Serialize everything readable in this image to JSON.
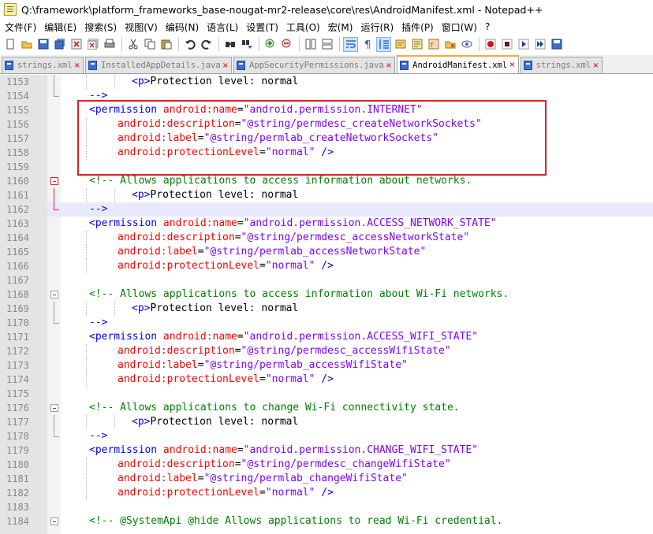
{
  "window": {
    "title": "Q:\\framework\\platform_frameworks_base-nougat-mr2-release\\core\\res\\AndroidManifest.xml - Notepad++"
  },
  "menu": [
    "文件(F)",
    "编辑(E)",
    "搜索(S)",
    "视图(V)",
    "编码(N)",
    "语言(L)",
    "设置(T)",
    "工具(O)",
    "宏(M)",
    "运行(R)",
    "插件(P)",
    "窗口(W)",
    "?"
  ],
  "toolbar": {
    "icons": [
      "new-file-icon",
      "open-file-icon",
      "save-icon",
      "save-all-icon",
      "close-icon",
      "close-all-icon",
      "print-icon",
      "cut-icon",
      "copy-icon",
      "paste-icon",
      "undo-icon",
      "redo-icon",
      "find-icon",
      "replace-icon",
      "zoom-in-icon",
      "zoom-out-icon",
      "sync-vertical-icon",
      "sync-horizontal-icon",
      "word-wrap-icon",
      "show-all-chars-icon",
      "indent-guide-icon",
      "udl-icon",
      "doc-map-icon",
      "function-list-icon",
      "folder-workspace-icon",
      "monitoring-icon",
      "record-macro-icon",
      "stop-record-icon",
      "play-macro-icon",
      "run-macro-multiple-icon",
      "save-macro-icon"
    ]
  },
  "tabs": [
    {
      "label": "strings.xml",
      "active": false
    },
    {
      "label": "InstalledAppDetails.java",
      "active": false
    },
    {
      "label": "AppSecurityPermissions.java",
      "active": false
    },
    {
      "label": "AndroidManifest.xml",
      "active": true
    },
    {
      "label": "strings.xml",
      "active": false
    }
  ],
  "editor": {
    "current_line": "1162",
    "lines": [
      {
        "n": "1153",
        "fold": "vline",
        "indent": 10,
        "segs": [
          [
            "tag",
            "<p>"
          ],
          [
            "plain",
            "Protection level: normal"
          ]
        ]
      },
      {
        "n": "1154",
        "fold": "end",
        "indent": 4,
        "segs": [
          [
            "tag",
            "-->"
          ]
        ]
      },
      {
        "n": "1155",
        "fold": "",
        "indent": 4,
        "segs": [
          [
            "tag",
            "<permission "
          ],
          [
            "attr",
            "android:name"
          ],
          [
            "plain",
            "="
          ],
          [
            "val",
            "\"android.permission.INTERNET\""
          ]
        ]
      },
      {
        "n": "1156",
        "fold": "",
        "indent": 8,
        "segs": [
          [
            "attr",
            "android:description"
          ],
          [
            "plain",
            "="
          ],
          [
            "val",
            "\"@string/permdesc_createNetworkSockets\""
          ]
        ]
      },
      {
        "n": "1157",
        "fold": "",
        "indent": 8,
        "segs": [
          [
            "attr",
            "android:label"
          ],
          [
            "plain",
            "="
          ],
          [
            "val",
            "\"@string/permlab_createNetworkSockets\""
          ]
        ]
      },
      {
        "n": "1158",
        "fold": "",
        "indent": 8,
        "segs": [
          [
            "attr",
            "android:protectionLevel"
          ],
          [
            "plain",
            "="
          ],
          [
            "val",
            "\"normal\""
          ],
          [
            "tag",
            " />"
          ]
        ]
      },
      {
        "n": "1159",
        "fold": "",
        "indent": 0,
        "segs": []
      },
      {
        "n": "1160",
        "fold": "box-red",
        "indent": 4,
        "segs": [
          [
            "cmt",
            "<!-- Allows applications to access information about networks."
          ]
        ]
      },
      {
        "n": "1161",
        "fold": "vline-red",
        "indent": 10,
        "segs": [
          [
            "tag",
            "<p>"
          ],
          [
            "plain",
            "Protection level: normal"
          ]
        ]
      },
      {
        "n": "1162",
        "fold": "end-red",
        "indent": 4,
        "segs": [
          [
            "tag",
            "-->"
          ]
        ]
      },
      {
        "n": "1163",
        "fold": "",
        "indent": 4,
        "segs": [
          [
            "tag",
            "<permission "
          ],
          [
            "attr",
            "android:name"
          ],
          [
            "plain",
            "="
          ],
          [
            "val",
            "\"android.permission.ACCESS_NETWORK_STATE\""
          ]
        ]
      },
      {
        "n": "1164",
        "fold": "",
        "indent": 8,
        "segs": [
          [
            "attr",
            "android:description"
          ],
          [
            "plain",
            "="
          ],
          [
            "val",
            "\"@string/permdesc_accessNetworkState\""
          ]
        ]
      },
      {
        "n": "1165",
        "fold": "",
        "indent": 8,
        "segs": [
          [
            "attr",
            "android:label"
          ],
          [
            "plain",
            "="
          ],
          [
            "val",
            "\"@string/permlab_accessNetworkState\""
          ]
        ]
      },
      {
        "n": "1166",
        "fold": "",
        "indent": 8,
        "segs": [
          [
            "attr",
            "android:protectionLevel"
          ],
          [
            "plain",
            "="
          ],
          [
            "val",
            "\"normal\""
          ],
          [
            "tag",
            " />"
          ]
        ]
      },
      {
        "n": "1167",
        "fold": "",
        "indent": 0,
        "segs": []
      },
      {
        "n": "1168",
        "fold": "box",
        "indent": 4,
        "segs": [
          [
            "cmt",
            "<!-- Allows applications to access information about Wi-Fi networks."
          ]
        ]
      },
      {
        "n": "1169",
        "fold": "vline",
        "indent": 10,
        "segs": [
          [
            "tag",
            "<p>"
          ],
          [
            "plain",
            "Protection level: normal"
          ]
        ]
      },
      {
        "n": "1170",
        "fold": "end",
        "indent": 4,
        "segs": [
          [
            "tag",
            "-->"
          ]
        ]
      },
      {
        "n": "1171",
        "fold": "",
        "indent": 4,
        "segs": [
          [
            "tag",
            "<permission "
          ],
          [
            "attr",
            "android:name"
          ],
          [
            "plain",
            "="
          ],
          [
            "val",
            "\"android.permission.ACCESS_WIFI_STATE\""
          ]
        ]
      },
      {
        "n": "1172",
        "fold": "",
        "indent": 8,
        "segs": [
          [
            "attr",
            "android:description"
          ],
          [
            "plain",
            "="
          ],
          [
            "val",
            "\"@string/permdesc_accessWifiState\""
          ]
        ]
      },
      {
        "n": "1173",
        "fold": "",
        "indent": 8,
        "segs": [
          [
            "attr",
            "android:label"
          ],
          [
            "plain",
            "="
          ],
          [
            "val",
            "\"@string/permlab_accessWifiState\""
          ]
        ]
      },
      {
        "n": "1174",
        "fold": "",
        "indent": 8,
        "segs": [
          [
            "attr",
            "android:protectionLevel"
          ],
          [
            "plain",
            "="
          ],
          [
            "val",
            "\"normal\""
          ],
          [
            "tag",
            " />"
          ]
        ]
      },
      {
        "n": "1175",
        "fold": "",
        "indent": 0,
        "segs": []
      },
      {
        "n": "1176",
        "fold": "box",
        "indent": 4,
        "segs": [
          [
            "cmt",
            "<!-- Allows applications to change Wi-Fi connectivity state."
          ]
        ]
      },
      {
        "n": "1177",
        "fold": "vline",
        "indent": 10,
        "segs": [
          [
            "tag",
            "<p>"
          ],
          [
            "plain",
            "Protection level: normal"
          ]
        ]
      },
      {
        "n": "1178",
        "fold": "end",
        "indent": 4,
        "segs": [
          [
            "tag",
            "-->"
          ]
        ]
      },
      {
        "n": "1179",
        "fold": "",
        "indent": 4,
        "segs": [
          [
            "tag",
            "<permission "
          ],
          [
            "attr",
            "android:name"
          ],
          [
            "plain",
            "="
          ],
          [
            "val",
            "\"android.permission.CHANGE_WIFI_STATE\""
          ]
        ]
      },
      {
        "n": "1180",
        "fold": "",
        "indent": 8,
        "segs": [
          [
            "attr",
            "android:description"
          ],
          [
            "plain",
            "="
          ],
          [
            "val",
            "\"@string/permdesc_changeWifiState\""
          ]
        ]
      },
      {
        "n": "1181",
        "fold": "",
        "indent": 8,
        "segs": [
          [
            "attr",
            "android:label"
          ],
          [
            "plain",
            "="
          ],
          [
            "val",
            "\"@string/permlab_changeWifiState\""
          ]
        ]
      },
      {
        "n": "1182",
        "fold": "",
        "indent": 8,
        "segs": [
          [
            "attr",
            "android:protectionLevel"
          ],
          [
            "plain",
            "="
          ],
          [
            "val",
            "\"normal\""
          ],
          [
            "tag",
            " />"
          ]
        ]
      },
      {
        "n": "1183",
        "fold": "",
        "indent": 0,
        "segs": []
      },
      {
        "n": "1184",
        "fold": "box",
        "indent": 4,
        "segs": [
          [
            "cmt",
            "<!-- @SystemApi @hide Allows applications to read Wi-Fi credential."
          ]
        ]
      }
    ]
  },
  "colors": {
    "tag": "#0000ff",
    "attribute": "#ff0000",
    "value": "#8000ff",
    "comment": "#008000",
    "current_line_bg": "#e8e8ff",
    "annotation_box": "#e0202a",
    "active_tab_accent": "#f9a642"
  }
}
